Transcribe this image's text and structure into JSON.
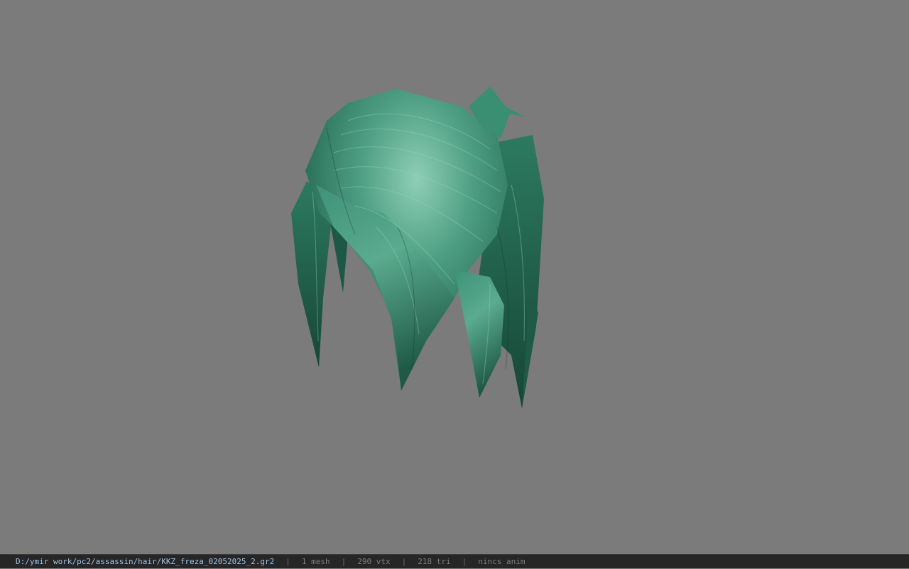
{
  "viewport": {
    "background": "#7b7b7b",
    "model": {
      "type": "hair-mesh",
      "base_color": "#2f7a61",
      "highlight_color": "#8fd1b7",
      "shadow_color": "#143b2f"
    }
  },
  "status": {
    "file_path": "D:/ymir work/pc2/assassin/hair/KKZ_freza_02052025_2.gr2",
    "separator": "|",
    "mesh": "1 mesh",
    "vertices": "290 vtx",
    "triangles": "218 tri",
    "animation": "nincs anim"
  }
}
